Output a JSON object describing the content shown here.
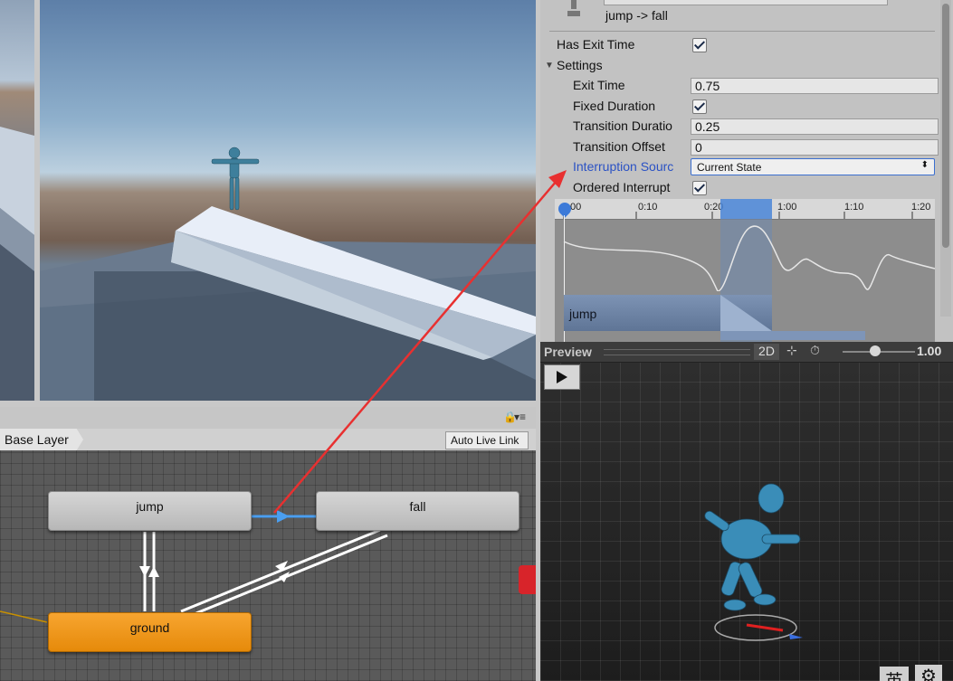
{
  "inspector": {
    "transition_title": "jump -> fall",
    "has_exit_time_label": "Has Exit Time",
    "has_exit_time": true,
    "settings_label": "Settings",
    "exit_time_label": "Exit Time",
    "exit_time": "0.75",
    "fixed_duration_label": "Fixed Duration",
    "fixed_duration": true,
    "transition_duration_label": "Transition Duratio",
    "transition_duration": "0.25",
    "transition_offset_label": "Transition Offset",
    "transition_offset": "0",
    "interruption_source_label": "Interruption Sourc",
    "interruption_source": "Current State",
    "ordered_interrupt_label": "Ordered Interrupt",
    "ordered_interrupt": true
  },
  "timeline": {
    "ticks": [
      ":00",
      "0:10",
      "0:20",
      "1:00",
      "1:10",
      "1:20"
    ],
    "track_label": "jump"
  },
  "preview": {
    "title": "Preview",
    "mode": "2D",
    "speed": "1.00",
    "footer_char": "英"
  },
  "animator": {
    "layer": "Base Layer",
    "auto_live_link": "Auto Live Link",
    "states": {
      "jump": "jump",
      "fall": "fall",
      "ground": "ground"
    }
  },
  "colors": {
    "accent_blue": "#4a86d8",
    "annotation_red": "#e83030",
    "default_state_orange": "#f29a1e"
  }
}
